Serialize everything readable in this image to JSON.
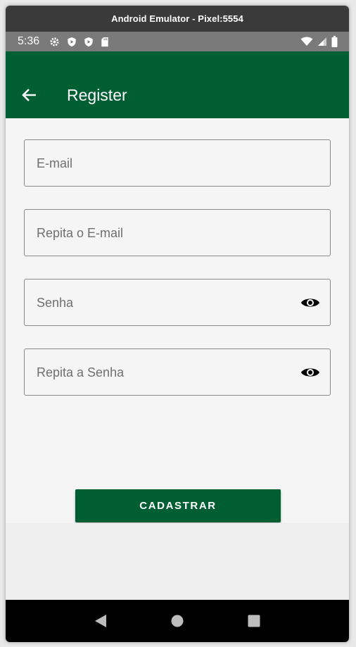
{
  "window": {
    "title": "Android Emulator - Pixel:5554"
  },
  "status_bar": {
    "time": "5:36",
    "left_icons": [
      "gear-icon",
      "play-protect-icon",
      "play-protect-icon",
      "sd-card-icon"
    ],
    "right_icons": [
      "wifi-icon",
      "signal-icon",
      "battery-icon"
    ]
  },
  "app_bar": {
    "title": "Register",
    "back_icon": "arrow-left-icon",
    "color": "#005e33"
  },
  "form": {
    "email_placeholder": "E-mail",
    "email_repeat_placeholder": "Repita o E-mail",
    "password_placeholder": "Senha",
    "password_repeat_placeholder": "Repita a Senha",
    "visibility_icon": "eye-icon"
  },
  "submit": {
    "label": "CADASTRAR",
    "color": "#005e33"
  },
  "nav_bar": {
    "icons": [
      "back-triangle-icon",
      "home-circle-icon",
      "recents-square-icon"
    ]
  }
}
